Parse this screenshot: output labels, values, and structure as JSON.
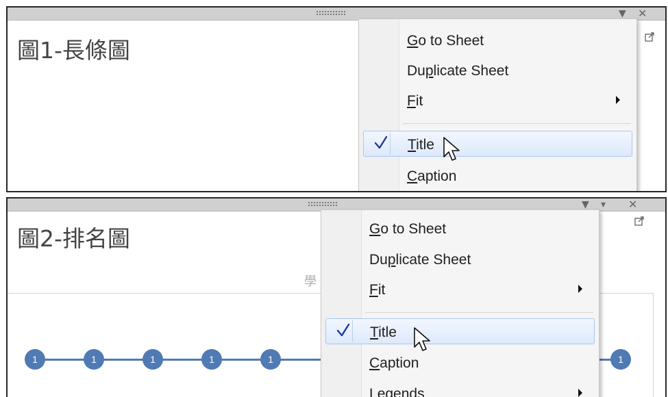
{
  "panel1": {
    "title": "圖1-長條圖",
    "menu": {
      "go_to_sheet": {
        "pre": "",
        "key": "G",
        "post": "o to Sheet"
      },
      "duplicate_sheet": {
        "pre": "Du",
        "key": "p",
        "post": "licate Sheet"
      },
      "fit": {
        "pre": "",
        "key": "F",
        "post": "it"
      },
      "title_item": {
        "pre": "",
        "key": "T",
        "post": "itle"
      },
      "caption": {
        "pre": "",
        "key": "C",
        "post": "aption"
      }
    }
  },
  "panel2": {
    "title": "圖2-排名圖",
    "chart_partial_text": "學",
    "nodes": [
      "1",
      "1",
      "1",
      "1",
      "1",
      "1"
    ],
    "menu": {
      "go_to_sheet": {
        "pre": "",
        "key": "G",
        "post": "o to Sheet"
      },
      "duplicate_sheet": {
        "pre": "Du",
        "key": "p",
        "post": "licate Sheet"
      },
      "fit": {
        "pre": "",
        "key": "F",
        "post": "it"
      },
      "title_item": {
        "pre": "",
        "key": "T",
        "post": "itle"
      },
      "caption": {
        "pre": "",
        "key": "C",
        "post": "aption"
      },
      "legends": {
        "pre": "",
        "key": "L",
        "post": "egends"
      }
    }
  },
  "icons": {
    "check": "checkmark-icon",
    "submenu": "submenu-arrow-icon",
    "popout": "popout-icon",
    "dropdown": "dropdown-arrow-icon",
    "close": "close-icon",
    "cursor": "mouse-pointer-icon"
  },
  "colors": {
    "highlight_border": "#a9c6ee",
    "check": "#1f3a9c",
    "node": "#4f7ab3"
  }
}
